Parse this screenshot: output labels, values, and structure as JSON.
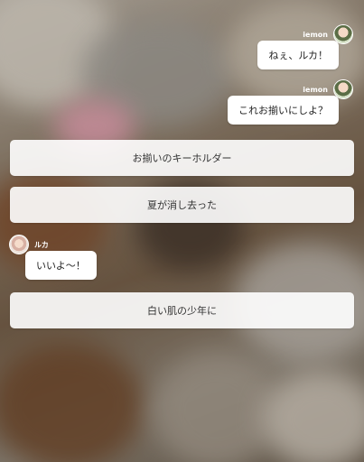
{
  "messages": [
    {
      "sender": "iemon",
      "text": "ねぇ、ルカ！",
      "side": "right"
    },
    {
      "sender": "iemon",
      "text": "これお揃いにしよ？",
      "side": "right"
    },
    {
      "sender": "ルカ",
      "text": "いいよ〜！",
      "side": "left"
    }
  ],
  "choices": [
    {
      "label": "お揃いのキーホルダー"
    },
    {
      "label": "夏が消し去った"
    },
    {
      "label": "白い肌の少年に"
    }
  ],
  "icons": {
    "avatar_iemon": "avatar-icon",
    "avatar_luka": "avatar-icon"
  }
}
